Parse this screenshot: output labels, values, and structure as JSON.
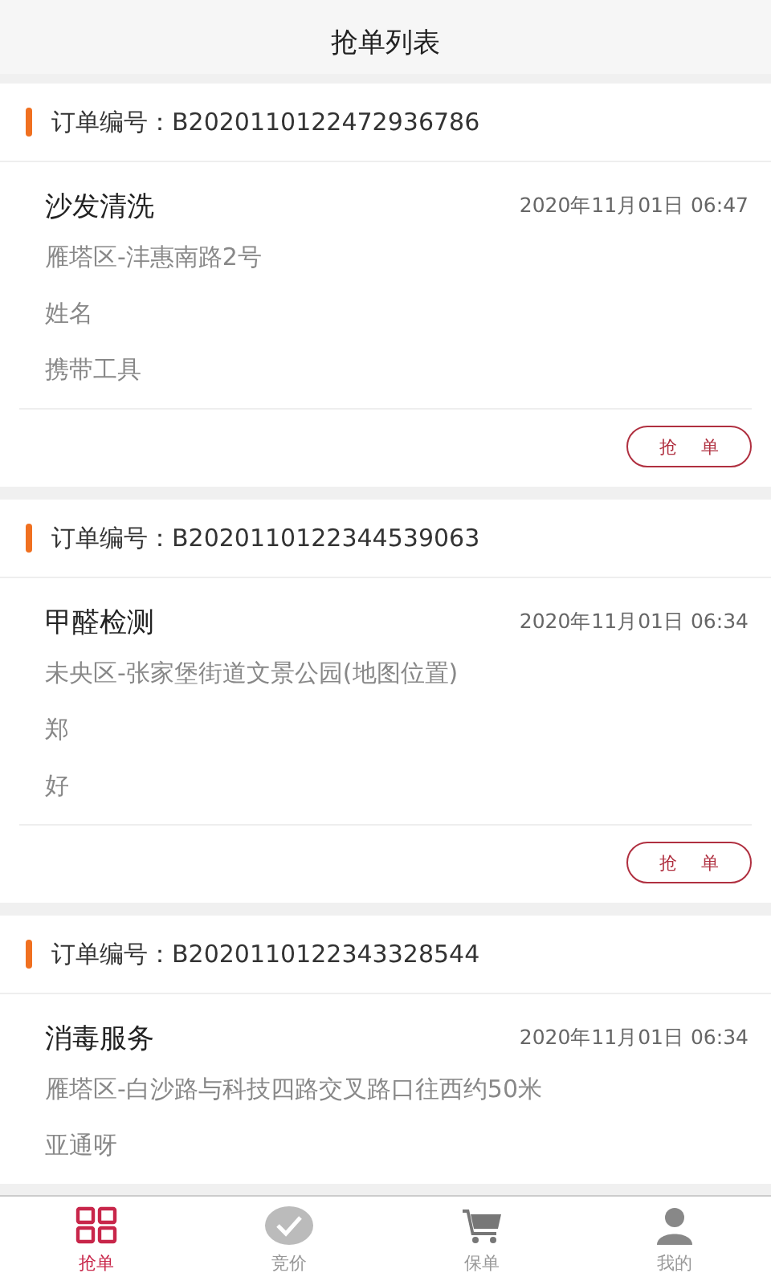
{
  "title": "抢单列表",
  "orders": [
    {
      "label": "订单编号：",
      "number": "B2020110122472936786",
      "service": "沙发清洗",
      "time": "2020年11月01日 06:47",
      "lines": [
        "雁塔区-沣惠南路2号",
        "姓名",
        "携带工具"
      ],
      "button": "抢 单"
    },
    {
      "label": "订单编号：",
      "number": "B2020110122344539063",
      "service": "甲醛检测",
      "time": "2020年11月01日 06:34",
      "lines": [
        "未央区-张家堡街道文景公园(地图位置)",
        "郑",
        "好"
      ],
      "button": "抢 单"
    },
    {
      "label": "订单编号：",
      "number": "B2020110122343328544",
      "service": "消毒服务",
      "time": "2020年11月01日 06:34",
      "lines": [
        "雁塔区-白沙路与科技四路交叉路口往西约50米",
        "亚通呀"
      ]
    }
  ],
  "tabs": [
    {
      "kind": "grid",
      "label": "抢单",
      "selected": true
    },
    {
      "kind": "check",
      "label": "竞价",
      "selected": false
    },
    {
      "kind": "cart",
      "label": "保单",
      "selected": false
    },
    {
      "kind": "person",
      "label": "我的",
      "selected": false
    }
  ]
}
